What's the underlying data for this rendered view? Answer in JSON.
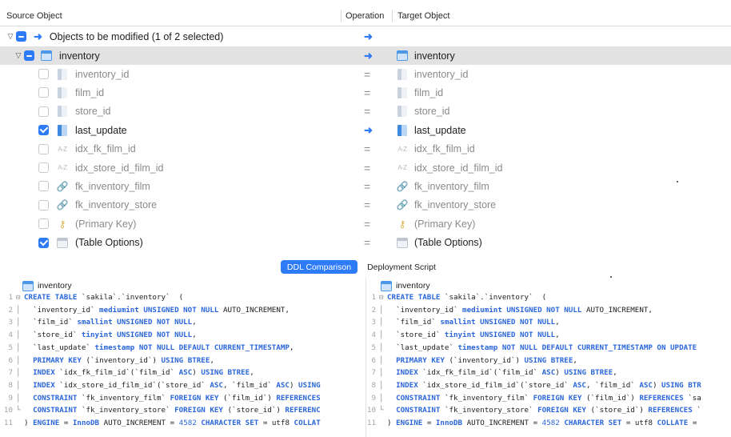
{
  "header": {
    "source_label": "Source Object",
    "operation_label": "Operation",
    "target_label": "Target Object"
  },
  "group": {
    "label": "Objects to be modified (1 of 2 selected)"
  },
  "table_row": {
    "source": "inventory",
    "target": "inventory"
  },
  "items": [
    {
      "source": "inventory_id",
      "target": "inventory_id",
      "op": "=",
      "checked": false,
      "icon": "column-icon"
    },
    {
      "source": "film_id",
      "target": "film_id",
      "op": "=",
      "checked": false,
      "icon": "column-icon"
    },
    {
      "source": "store_id",
      "target": "store_id",
      "op": "=",
      "checked": false,
      "icon": "column-icon"
    },
    {
      "source": "last_update",
      "target": "last_update",
      "op": "→",
      "checked": true,
      "icon": "column-icon"
    },
    {
      "source": "idx_fk_film_id",
      "target": "idx_fk_film_id",
      "op": "=",
      "checked": false,
      "icon": "index-icon",
      "icon_text": "A-Z"
    },
    {
      "source": "idx_store_id_film_id",
      "target": "idx_store_id_film_id",
      "op": "=",
      "checked": false,
      "icon": "index-icon",
      "icon_text": "A-Z"
    },
    {
      "source": "fk_inventory_film",
      "target": "fk_inventory_film",
      "op": "=",
      "checked": false,
      "icon": "foreign-key-icon"
    },
    {
      "source": "fk_inventory_store",
      "target": "fk_inventory_store",
      "op": "=",
      "checked": false,
      "icon": "foreign-key-icon"
    },
    {
      "source": "(Primary Key)",
      "target": "(Primary Key)",
      "op": "=",
      "checked": false,
      "icon": "key-icon"
    },
    {
      "source": "(Table Options)",
      "target": "(Table Options)",
      "op": "=",
      "checked": true,
      "icon": "table-options-icon"
    }
  ],
  "tabs": {
    "ddl": "DDL Comparison",
    "deploy": "Deployment Script"
  },
  "left_pane": {
    "title": "inventory",
    "lines": [
      {
        "n": "1",
        "f": "⊟",
        "segs": [
          [
            "kw",
            "CREATE TABLE"
          ],
          [
            "t",
            " `sakila`.`inventory`  ("
          ]
        ]
      },
      {
        "n": "2",
        "f": "│",
        "segs": [
          [
            "t",
            "  `inventory_id` "
          ],
          [
            "kw",
            "mediumint UNSIGNED NOT NULL"
          ],
          [
            "t",
            " AUTO_INCREMENT,"
          ]
        ]
      },
      {
        "n": "3",
        "f": "│",
        "segs": [
          [
            "t",
            "  `film_id` "
          ],
          [
            "kw",
            "smallint UNSIGNED NOT NULL"
          ],
          [
            "t",
            ","
          ]
        ]
      },
      {
        "n": "4",
        "f": "│",
        "segs": [
          [
            "t",
            "  `store_id` "
          ],
          [
            "kw",
            "tinyint UNSIGNED NOT NULL"
          ],
          [
            "t",
            ","
          ]
        ]
      },
      {
        "n": "5",
        "f": "│",
        "segs": [
          [
            "t",
            "  `last_update` "
          ],
          [
            "kw",
            "timestamp NOT NULL DEFAULT CURRENT_TIMESTAMP"
          ],
          [
            "t",
            ","
          ]
        ]
      },
      {
        "n": "6",
        "f": "│",
        "segs": [
          [
            "t",
            "  "
          ],
          [
            "kw",
            "PRIMARY KEY"
          ],
          [
            "t",
            " (`inventory_id`) "
          ],
          [
            "kw",
            "USING BTREE"
          ],
          [
            "t",
            ","
          ]
        ]
      },
      {
        "n": "7",
        "f": "│",
        "segs": [
          [
            "t",
            "  "
          ],
          [
            "kw",
            "INDEX"
          ],
          [
            "t",
            " `idx_fk_film_id`(`film_id` "
          ],
          [
            "kw",
            "ASC"
          ],
          [
            "t",
            ") "
          ],
          [
            "kw",
            "USING BTREE"
          ],
          [
            "t",
            ","
          ]
        ]
      },
      {
        "n": "8",
        "f": "│",
        "segs": [
          [
            "t",
            "  "
          ],
          [
            "kw",
            "INDEX"
          ],
          [
            "t",
            " `idx_store_id_film_id`(`store_id` "
          ],
          [
            "kw",
            "ASC"
          ],
          [
            "t",
            ", `film_id` "
          ],
          [
            "kw",
            "ASC"
          ],
          [
            "t",
            ") "
          ],
          [
            "kw",
            "USING"
          ]
        ]
      },
      {
        "n": "9",
        "f": "│",
        "segs": [
          [
            "t",
            "  "
          ],
          [
            "kw",
            "CONSTRAINT"
          ],
          [
            "t",
            " `fk_inventory_film` "
          ],
          [
            "kw",
            "FOREIGN KEY"
          ],
          [
            "t",
            " (`film_id`) "
          ],
          [
            "kw",
            "REFERENCES"
          ]
        ]
      },
      {
        "n": "10",
        "f": "└",
        "segs": [
          [
            "t",
            "  "
          ],
          [
            "kw",
            "CONSTRAINT"
          ],
          [
            "t",
            " `fk_inventory_store` "
          ],
          [
            "kw",
            "FOREIGN KEY"
          ],
          [
            "t",
            " (`store_id`) "
          ],
          [
            "kw",
            "REFERENC"
          ]
        ]
      },
      {
        "n": "11",
        "f": " ",
        "segs": [
          [
            "t",
            ") "
          ],
          [
            "kw",
            "ENGINE"
          ],
          [
            "t",
            " = "
          ],
          [
            "kw",
            "InnoDB"
          ],
          [
            "t",
            " AUTO_INCREMENT = "
          ],
          [
            "num",
            "4582"
          ],
          [
            "t",
            " "
          ],
          [
            "kw",
            "CHARACTER SET"
          ],
          [
            "t",
            " = utf8 "
          ],
          [
            "kw",
            "COLLAT"
          ]
        ]
      }
    ]
  },
  "right_pane": {
    "title": "inventory",
    "lines": [
      {
        "n": "1",
        "f": "⊟",
        "segs": [
          [
            "kw",
            "CREATE TABLE"
          ],
          [
            "t",
            " `sakila`.`inventory`  ("
          ]
        ]
      },
      {
        "n": "2",
        "f": "│",
        "segs": [
          [
            "t",
            "  `inventory_id` "
          ],
          [
            "kw",
            "mediumint UNSIGNED NOT NULL"
          ],
          [
            "t",
            " AUTO_INCREMENT,"
          ]
        ]
      },
      {
        "n": "3",
        "f": "│",
        "segs": [
          [
            "t",
            "  `film_id` "
          ],
          [
            "kw",
            "smallint UNSIGNED NOT NULL"
          ],
          [
            "t",
            ","
          ]
        ]
      },
      {
        "n": "4",
        "f": "│",
        "segs": [
          [
            "t",
            "  `store_id` "
          ],
          [
            "kw",
            "tinyint UNSIGNED NOT NULL"
          ],
          [
            "t",
            ","
          ]
        ]
      },
      {
        "n": "5",
        "f": "│",
        "segs": [
          [
            "t",
            "  `last_update` "
          ],
          [
            "kw",
            "timestamp NOT NULL DEFAULT CURRENT_TIMESTAMP ON UPDATE"
          ]
        ]
      },
      {
        "n": "6",
        "f": "│",
        "segs": [
          [
            "t",
            "  "
          ],
          [
            "kw",
            "PRIMARY KEY"
          ],
          [
            "t",
            " (`inventory_id`) "
          ],
          [
            "kw",
            "USING BTREE"
          ],
          [
            "t",
            ","
          ]
        ]
      },
      {
        "n": "7",
        "f": "│",
        "segs": [
          [
            "t",
            "  "
          ],
          [
            "kw",
            "INDEX"
          ],
          [
            "t",
            " `idx_fk_film_id`(`film_id` "
          ],
          [
            "kw",
            "ASC"
          ],
          [
            "t",
            ") "
          ],
          [
            "kw",
            "USING BTREE"
          ],
          [
            "t",
            ","
          ]
        ]
      },
      {
        "n": "8",
        "f": "│",
        "segs": [
          [
            "t",
            "  "
          ],
          [
            "kw",
            "INDEX"
          ],
          [
            "t",
            " `idx_store_id_film_id`(`store_id` "
          ],
          [
            "kw",
            "ASC"
          ],
          [
            "t",
            ", `film_id` "
          ],
          [
            "kw",
            "ASC"
          ],
          [
            "t",
            ") "
          ],
          [
            "kw",
            "USING BTR"
          ]
        ]
      },
      {
        "n": "9",
        "f": "│",
        "segs": [
          [
            "t",
            "  "
          ],
          [
            "kw",
            "CONSTRAINT"
          ],
          [
            "t",
            " `fk_inventory_film` "
          ],
          [
            "kw",
            "FOREIGN KEY"
          ],
          [
            "t",
            " (`film_id`) "
          ],
          [
            "kw",
            "REFERENCES"
          ],
          [
            "t",
            " `sa"
          ]
        ]
      },
      {
        "n": "10",
        "f": "└",
        "segs": [
          [
            "t",
            "  "
          ],
          [
            "kw",
            "CONSTRAINT"
          ],
          [
            "t",
            " `fk_inventory_store` "
          ],
          [
            "kw",
            "FOREIGN KEY"
          ],
          [
            "t",
            " (`store_id`) "
          ],
          [
            "kw",
            "REFERENCES"
          ],
          [
            "t",
            " `"
          ]
        ]
      },
      {
        "n": "11",
        "f": " ",
        "segs": [
          [
            "t",
            ") "
          ],
          [
            "kw",
            "ENGINE"
          ],
          [
            "t",
            " = "
          ],
          [
            "kw",
            "InnoDB"
          ],
          [
            "t",
            " AUTO_INCREMENT = "
          ],
          [
            "num",
            "4582"
          ],
          [
            "t",
            " "
          ],
          [
            "kw",
            "CHARACTER SET"
          ],
          [
            "t",
            " = utf8 "
          ],
          [
            "kw",
            "COLLATE"
          ],
          [
            "t",
            " ="
          ]
        ]
      }
    ]
  },
  "colors": {
    "accent": "#2d7bf6",
    "keyword": "#2a66d9",
    "selected_row": "#e2e2e2"
  }
}
